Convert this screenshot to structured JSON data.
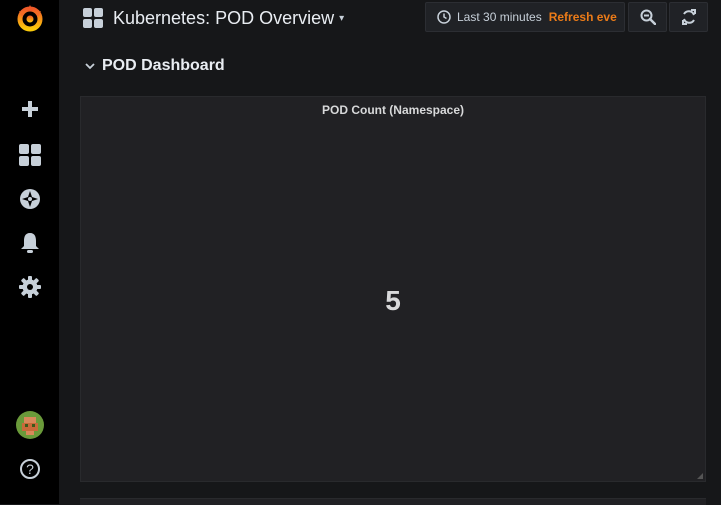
{
  "header": {
    "dashboard_title": "Kubernetes: POD Overview",
    "time_range": "Last 30 minutes",
    "refresh_label": "Refresh eve"
  },
  "row": {
    "title": "POD Dashboard"
  },
  "panel": {
    "title": "POD Count (Namespace)",
    "value": "5"
  },
  "sidebar": {
    "items": [
      {
        "icon": "plus-icon"
      },
      {
        "icon": "dashboards-icon"
      },
      {
        "icon": "explore-compass-icon"
      },
      {
        "icon": "alerting-bell-icon"
      },
      {
        "icon": "configuration-gear-icon"
      }
    ],
    "help_label": "?"
  },
  "colors": {
    "brand_orange": "#eb7b18",
    "background": "#161719",
    "panel": "#212124",
    "sidebar": "#000000"
  }
}
